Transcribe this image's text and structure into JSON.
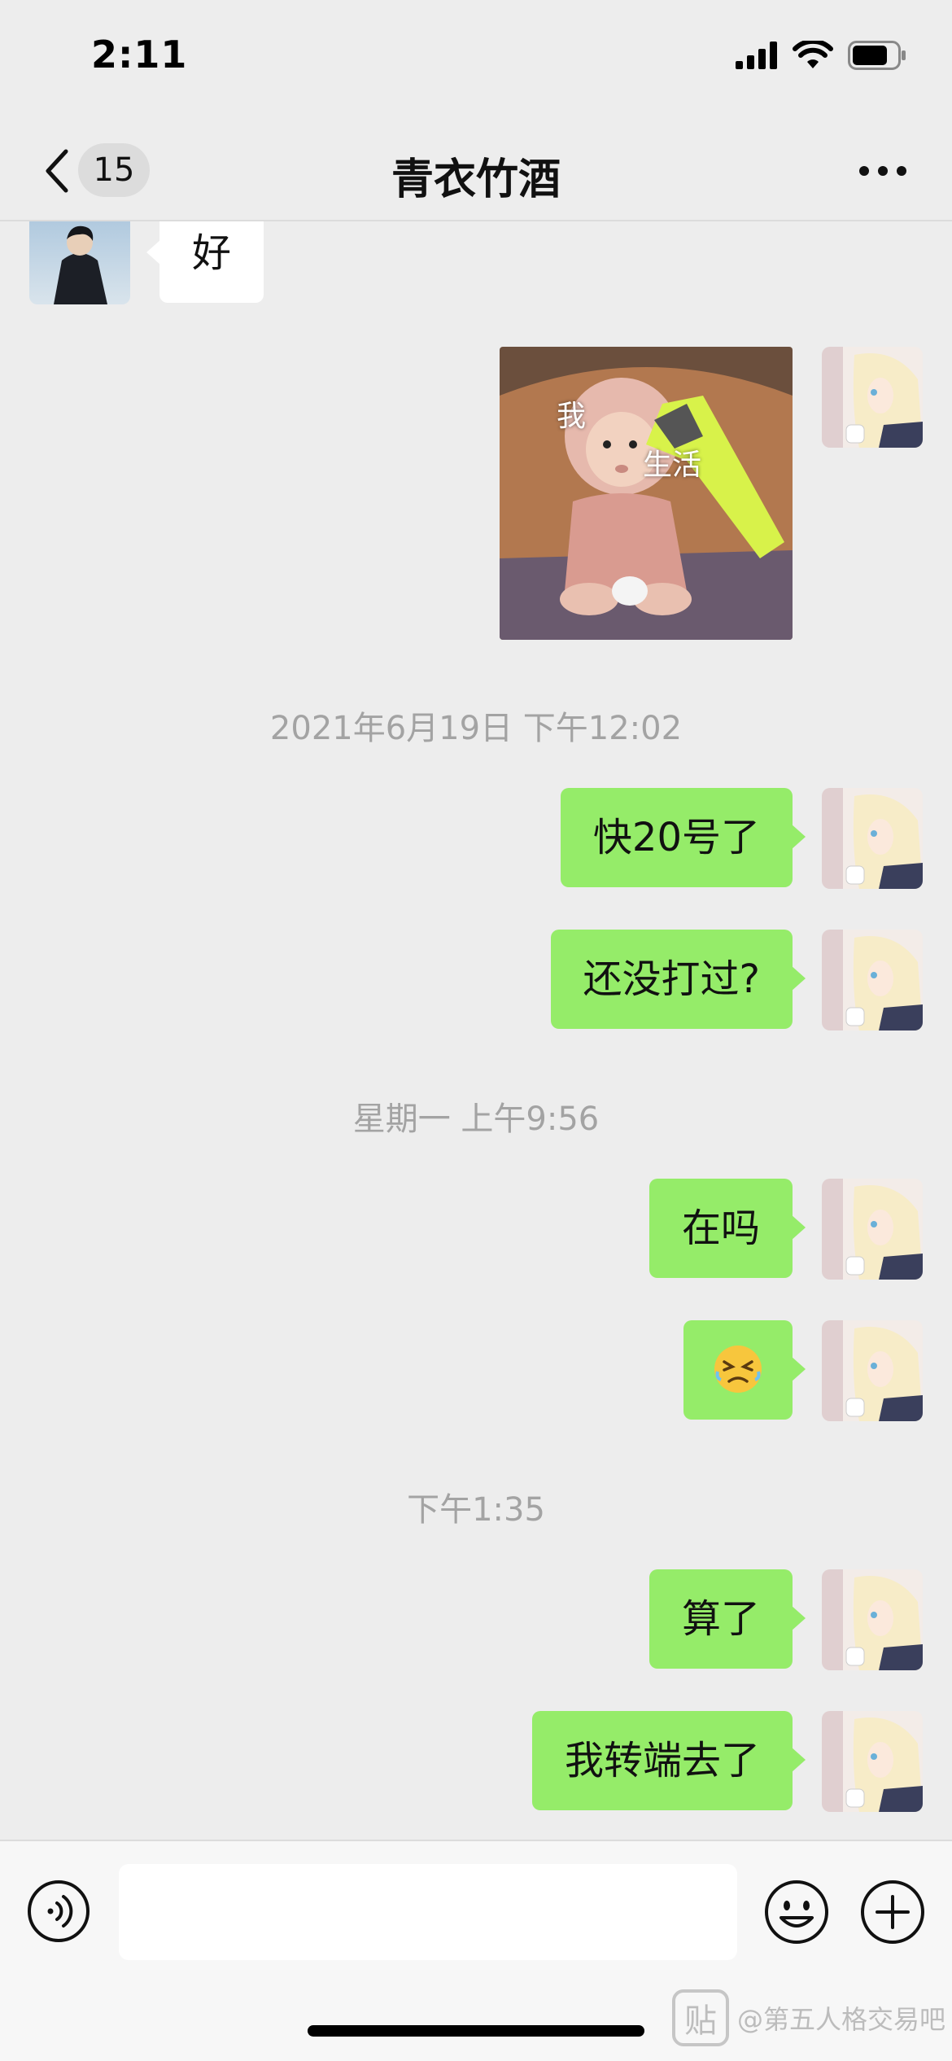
{
  "status_bar": {
    "time": "2:11"
  },
  "nav": {
    "unread_count": "15",
    "title": "青衣竹酒"
  },
  "messages": [
    {
      "type": "text",
      "side": "left",
      "text": "好"
    },
    {
      "type": "sticker",
      "side": "right",
      "labels": [
        "我",
        "生活"
      ]
    },
    {
      "type": "timestamp",
      "text": "2021年6月19日 下午12:02"
    },
    {
      "type": "text",
      "side": "right",
      "text": "快20号了"
    },
    {
      "type": "text",
      "side": "right",
      "text": "还没打过?"
    },
    {
      "type": "timestamp",
      "text": "星期一 上午9:56"
    },
    {
      "type": "text",
      "side": "right",
      "text": "在吗"
    },
    {
      "type": "text",
      "side": "right",
      "text": "😣"
    },
    {
      "type": "timestamp",
      "text": "下午1:35"
    },
    {
      "type": "text",
      "side": "right",
      "text": "算了"
    },
    {
      "type": "text",
      "side": "right",
      "text": "我转端去了"
    }
  ],
  "input": {
    "value": ""
  },
  "watermark": {
    "logo": "贴",
    "text": "@第五人格交易吧"
  },
  "colors": {
    "background": "#ededed",
    "sent_bubble": "#95ec69",
    "received_bubble": "#ffffff",
    "timestamp_text": "#a3a3a3"
  },
  "icons": {
    "back": "chevron-left-icon",
    "more": "more-dots-icon",
    "voice": "voice-icon",
    "emoji": "emoji-icon",
    "plus": "plus-icon",
    "signal": "signal-icon",
    "wifi": "wifi-icon",
    "battery": "battery-icon"
  }
}
